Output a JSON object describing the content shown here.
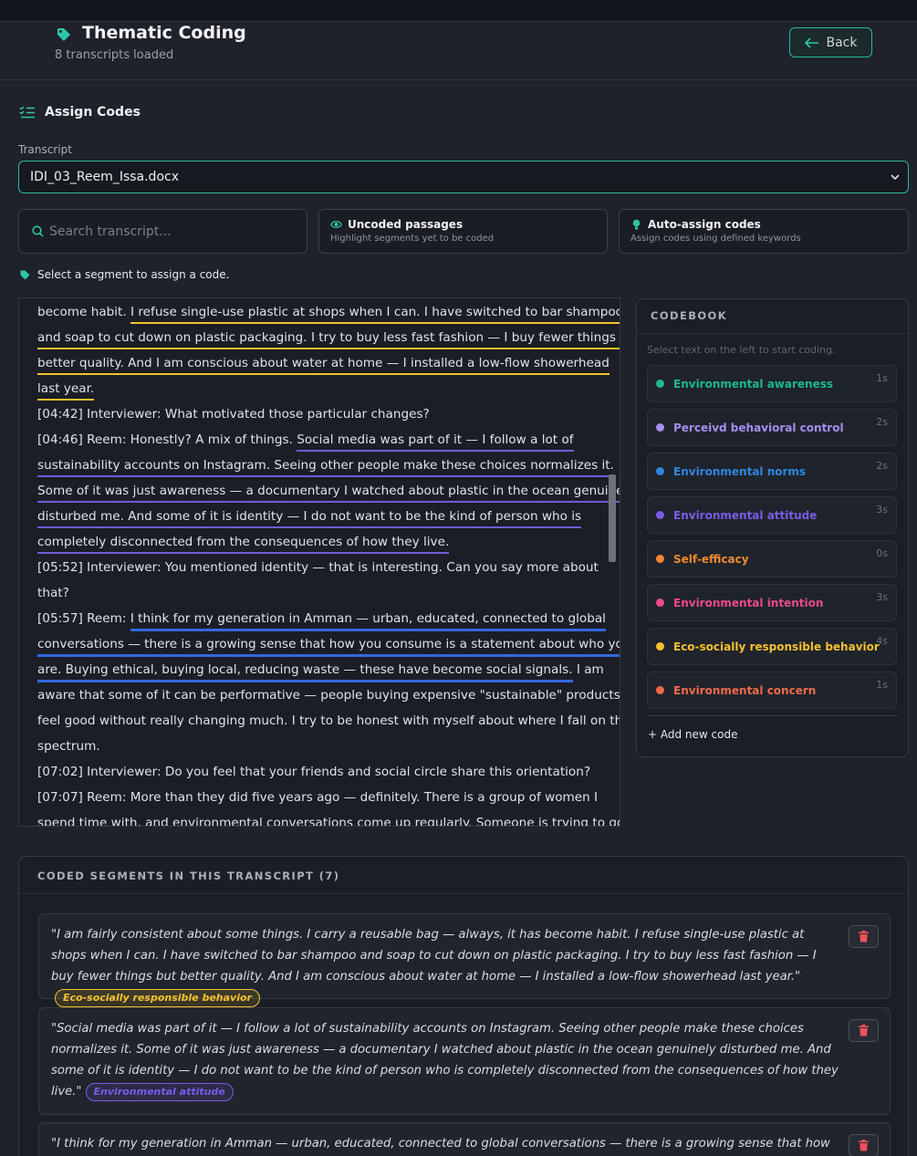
{
  "header": {
    "title": "Thematic Coding",
    "subtitle": "8 transcripts loaded",
    "back_label": "Back"
  },
  "assign": {
    "title": "Assign Codes",
    "transcript_label": "Transcript",
    "transcript_value": "IDI_03_Reem_Issa.docx",
    "search_placeholder": "Search transcript...",
    "uncoded_title": "Uncoded passages",
    "uncoded_sub": "Highlight segments yet to be coded",
    "auto_title": "Auto-assign codes",
    "auto_sub": "Assign codes using defined keywords",
    "hint": "Select a segment to assign a code."
  },
  "transcript_lines": [
    [
      {
        "t": "become habit. "
      },
      {
        "t": "I refuse single-use plastic at shops when I can. I have switched to bar shampoo",
        "u": "yellow"
      }
    ],
    [
      {
        "t": "and soap to cut down on plastic packaging. I try to buy less fast fashion — I buy fewer things but",
        "u": "yellow"
      }
    ],
    [
      {
        "t": "better quality. And I am conscious about water at home — I installed a low-flow showerhead",
        "u": "yellow"
      }
    ],
    [
      {
        "t": "last year.",
        "u": "yellow"
      }
    ],
    [
      {
        "t": "[04:42]  Interviewer:  What motivated those particular changes?"
      }
    ],
    [
      {
        "t": "[04:46]  Reem:  Honestly? A mix of things. "
      },
      {
        "t": "Social media was part of it — I follow a lot of",
        "u": "purple"
      }
    ],
    [
      {
        "t": "sustainability accounts on Instagram. Seeing other people make these choices normalizes it.",
        "u": "purple"
      }
    ],
    [
      {
        "t": "Some of it was just awareness — a documentary I watched about plastic in the ocean genuinely",
        "u": "purple"
      }
    ],
    [
      {
        "t": "disturbed me. And some of it is identity — I do not want to be the kind of person who is",
        "u": "purple"
      }
    ],
    [
      {
        "t": "completely disconnected from the consequences of how they live.",
        "u": "purple"
      }
    ],
    [
      {
        "t": "[05:52]  Interviewer:  You mentioned identity — that is interesting. Can you say more about"
      }
    ],
    [
      {
        "t": "that?"
      }
    ],
    [
      {
        "t": "[05:57]  Reem:  "
      },
      {
        "t": "I think for my generation in Amman — urban, educated, connected to global",
        "u": "blue"
      }
    ],
    [
      {
        "t": "conversations — there is a growing sense that how you consume is a statement about who you",
        "u": "blue"
      }
    ],
    [
      {
        "t": "are. Buying ethical, buying local, reducing waste — these have become social signals.",
        "u": "blue"
      },
      {
        "t": " I am"
      }
    ],
    [
      {
        "t": "aware that some of it can be performative — people buying expensive \"sustainable\" products to"
      }
    ],
    [
      {
        "t": "feel good without really changing much. I try to be honest with myself about where I fall on that"
      }
    ],
    [
      {
        "t": "spectrum."
      }
    ],
    [
      {
        "t": "[07:02]  Interviewer:  Do you feel that your friends and social circle share this orientation?"
      }
    ],
    [
      {
        "t": "[07:07]  Reem:  More than they did five years ago — definitely. There is a group of women I"
      }
    ],
    [
      {
        "t": "spend time with, and environmental conversations come up regularly. Someone is trying to go"
      }
    ]
  ],
  "codebook": {
    "title": "CODEBOOK",
    "hint": "Select text on the left to start coding.",
    "codes": [
      {
        "name": "Environmental awareness",
        "count": "1s",
        "color": "#1fb98b"
      },
      {
        "name": "Perceivd behavioral control",
        "count": "2s",
        "color": "#a48ef0"
      },
      {
        "name": "Environmental norms",
        "count": "2s",
        "color": "#2f86e0"
      },
      {
        "name": "Environmental attitude",
        "count": "3s",
        "color": "#7a5ce8"
      },
      {
        "name": "Self-efficacy",
        "count": "0s",
        "color": "#f08a2e"
      },
      {
        "name": "Environmental intention",
        "count": "3s",
        "color": "#ec4a88"
      },
      {
        "name": "Eco-socially responsible behavior",
        "count": "4s",
        "color": "#f5c12e"
      },
      {
        "name": "Environmental concern",
        "count": "1s",
        "color": "#ee6a4a"
      }
    ],
    "add_label": "+ Add new code"
  },
  "coded_segments": {
    "title": "CODED SEGMENTS IN THIS TRANSCRIPT (7)",
    "items": [
      {
        "quote": "\"I am fairly consistent about some things. I carry a reusable bag — always, it has become habit. I refuse single-use plastic at shops when I can. I have switched to bar shampoo and soap to cut down on plastic packaging. I try to buy less fast fashion — I buy fewer things but better quality. And I am conscious about water at home — I installed a low-flow showerhead last year.\"",
        "code": "Eco-socially responsible behavior",
        "color": "#f5c12e"
      },
      {
        "quote": "\"Social media was part of it — I follow a lot of sustainability accounts on Instagram. Seeing other people make these choices normalizes it. Some of it was just awareness — a documentary I watched about plastic in the ocean genuinely disturbed me. And some of it is identity — I do not want to be the kind of person who is completely disconnected from the consequences of how they live.\"",
        "code": "Environmental attitude",
        "color": "#7a5ce8"
      },
      {
        "quote": "\"I think for my generation in Amman — urban, educated, connected to global conversations — there is a growing sense that how you",
        "code": "",
        "color": "#3567e0"
      }
    ]
  }
}
